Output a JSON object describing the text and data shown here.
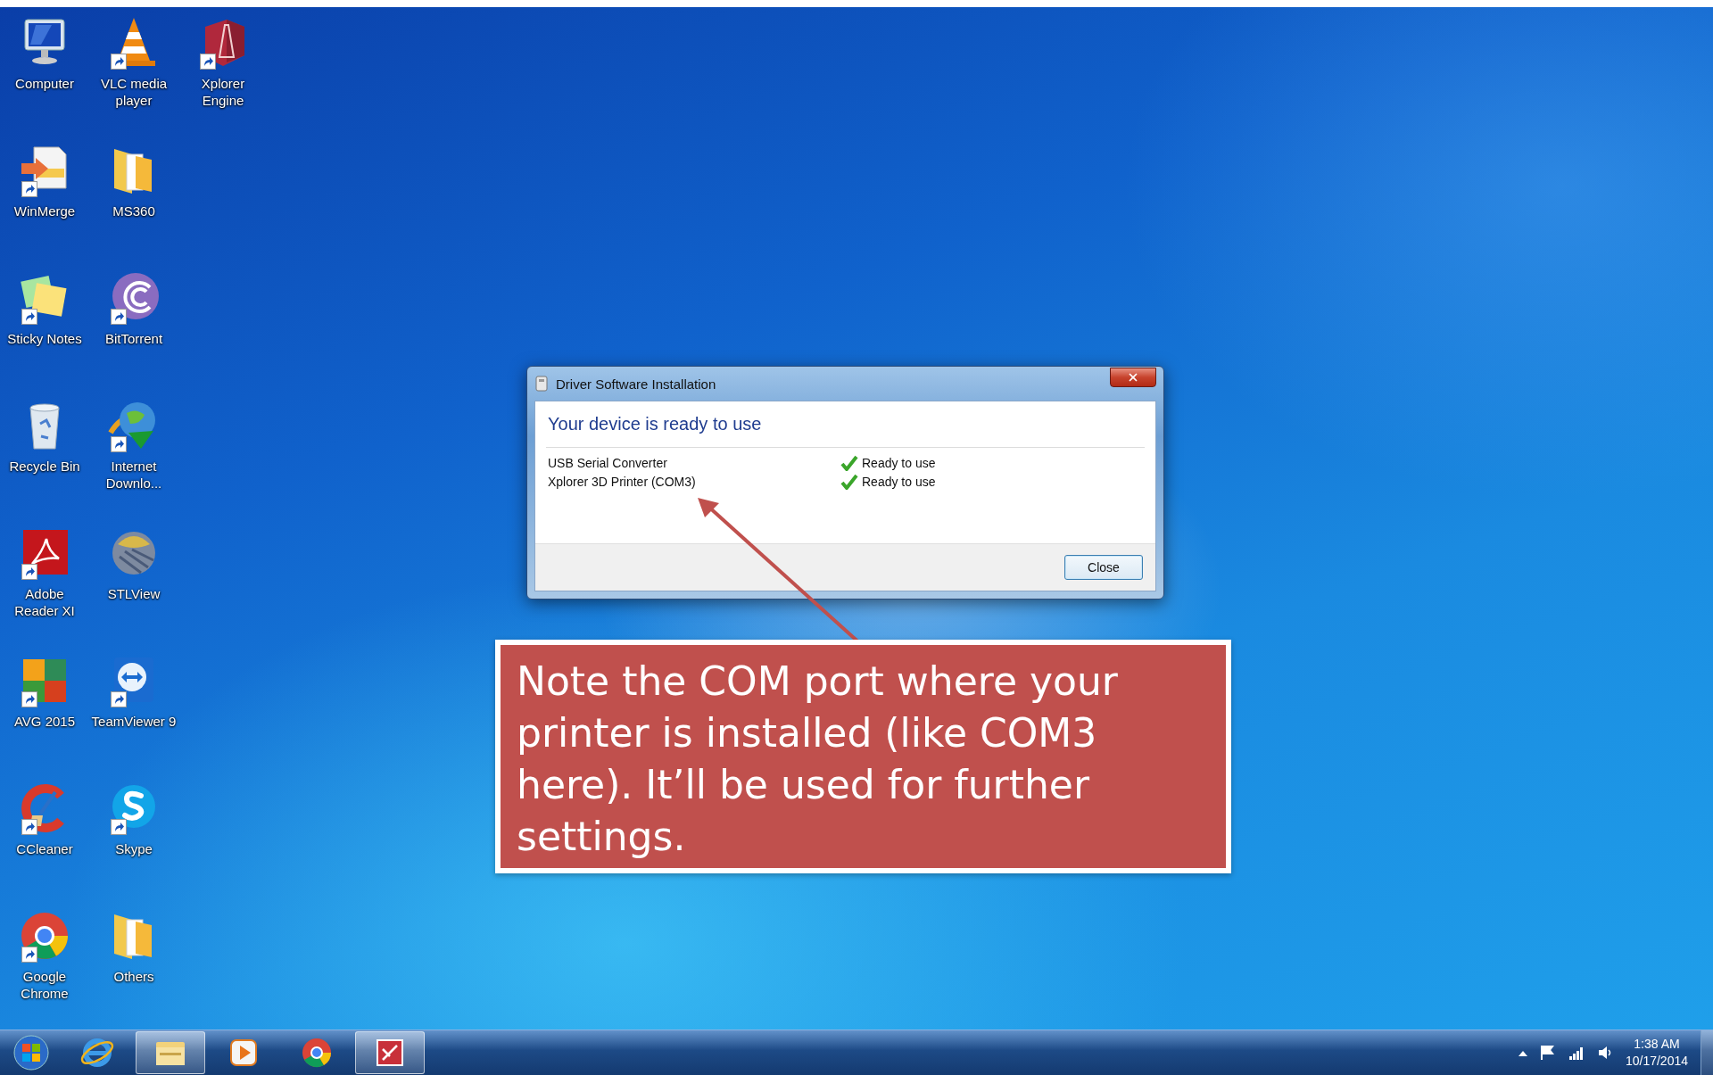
{
  "desktop_icons": [
    {
      "label": "Computer",
      "kind": "computer",
      "shortcut": false
    },
    {
      "label": "WinMerge",
      "kind": "winmerge",
      "shortcut": true
    },
    {
      "label": "Sticky Notes",
      "kind": "notes",
      "shortcut": true
    },
    {
      "label": "Recycle Bin",
      "kind": "recycle",
      "shortcut": false
    },
    {
      "label": "Adobe Reader XI",
      "kind": "pdf",
      "shortcut": true
    },
    {
      "label": "AVG 2015",
      "kind": "avg",
      "shortcut": true
    },
    {
      "label": "CCleaner",
      "kind": "ccleaner",
      "shortcut": true
    },
    {
      "label": "Google Chrome",
      "kind": "chrome",
      "shortcut": true
    },
    {
      "label": "VLC media player",
      "kind": "cone",
      "shortcut": true
    },
    {
      "label": "MS360",
      "kind": "folder",
      "shortcut": false
    },
    {
      "label": "BitTorrent",
      "kind": "swirl",
      "shortcut": true
    },
    {
      "label": "Internet Downlo...",
      "kind": "globe",
      "shortcut": true
    },
    {
      "label": "STLView",
      "kind": "sphere",
      "shortcut": false
    },
    {
      "label": "TeamViewer 9",
      "kind": "teamviewer",
      "shortcut": true
    },
    {
      "label": "Skype",
      "kind": "skype",
      "shortcut": true
    },
    {
      "label": "Others",
      "kind": "folder",
      "shortcut": false
    },
    {
      "label": "Xplorer Engine",
      "kind": "cube",
      "shortcut": true
    }
  ],
  "dialog": {
    "title": "Driver Software Installation",
    "heading": "Your device is ready to use",
    "devices": [
      {
        "name": "USB Serial Converter",
        "status": "Ready to use",
        "ok": true
      },
      {
        "name": "Xplorer 3D Printer (COM3)",
        "status": "Ready to use",
        "ok": true
      }
    ],
    "button": "Close"
  },
  "callout": {
    "text": "Note the COM port where your printer is installed (like COM3 here). It’ll be used for further settings."
  },
  "taskbar": {
    "items": [
      {
        "kind": "start",
        "selected": false
      },
      {
        "kind": "browser",
        "selected": false
      },
      {
        "kind": "explorer",
        "selected": true
      },
      {
        "kind": "media",
        "selected": false
      },
      {
        "kind": "chrome",
        "selected": false
      },
      {
        "kind": "app",
        "selected": true
      }
    ],
    "time": "1:38 AM",
    "date": "10/17/2014"
  }
}
